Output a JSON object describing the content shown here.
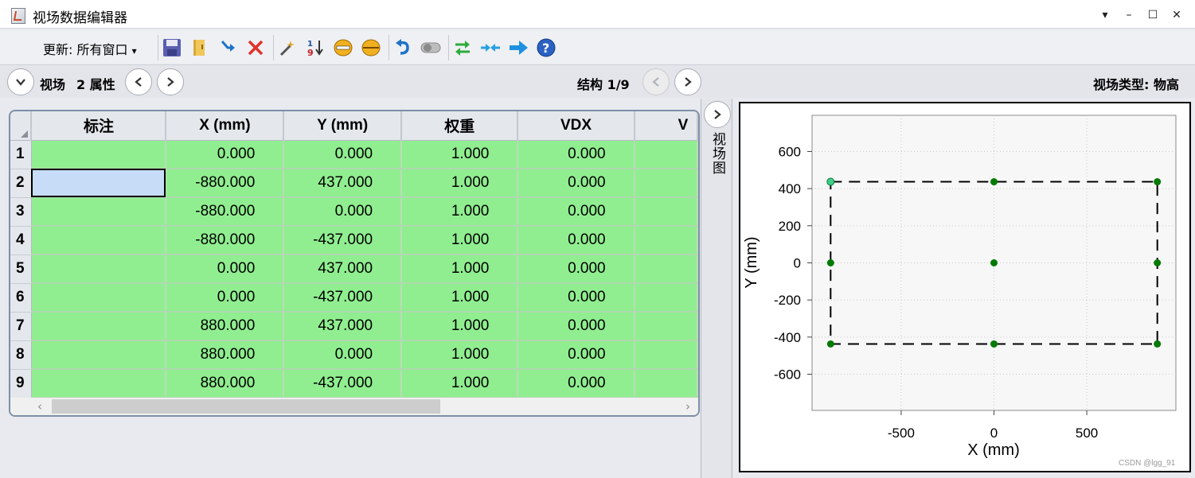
{
  "window": {
    "title": "视场数据编辑器",
    "controls": [
      "▾",
      "–",
      "☐",
      "✕"
    ]
  },
  "toolbar": {
    "update_label": "更新: 所有窗口",
    "update_arrow": "▾"
  },
  "nav": {
    "field_label": "视场",
    "property_label": "2 属性",
    "structure_label": "结构 1/9",
    "field_type_label": "视场类型: 物高"
  },
  "table": {
    "columns": [
      "标注",
      "X (mm)",
      "Y (mm)",
      "权重",
      "VDX",
      "V"
    ],
    "rows": [
      {
        "num": "1",
        "label": "",
        "x": "0.000",
        "y": "0.000",
        "weight": "1.000",
        "vdx": "0.000"
      },
      {
        "num": "2",
        "label": "",
        "x": "-880.000",
        "y": "437.000",
        "weight": "1.000",
        "vdx": "0.000"
      },
      {
        "num": "3",
        "label": "",
        "x": "-880.000",
        "y": "0.000",
        "weight": "1.000",
        "vdx": "0.000"
      },
      {
        "num": "4",
        "label": "",
        "x": "-880.000",
        "y": "-437.000",
        "weight": "1.000",
        "vdx": "0.000"
      },
      {
        "num": "5",
        "label": "",
        "x": "0.000",
        "y": "437.000",
        "weight": "1.000",
        "vdx": "0.000"
      },
      {
        "num": "6",
        "label": "",
        "x": "0.000",
        "y": "-437.000",
        "weight": "1.000",
        "vdx": "0.000"
      },
      {
        "num": "7",
        "label": "",
        "x": "880.000",
        "y": "437.000",
        "weight": "1.000",
        "vdx": "0.000"
      },
      {
        "num": "8",
        "label": "",
        "x": "880.000",
        "y": "0.000",
        "weight": "1.000",
        "vdx": "0.000"
      },
      {
        "num": "9",
        "label": "",
        "x": "880.000",
        "y": "-437.000",
        "weight": "1.000",
        "vdx": "0.000"
      }
    ]
  },
  "side_panel": {
    "label": "视场图"
  },
  "watermark": "CSDN @lgg_91",
  "colors": {
    "cell_green": "#90ee90",
    "selected_cell": "#c7dcf6",
    "point_green": "#007a00",
    "point_selected": "#3fcf86"
  },
  "chart_data": {
    "type": "scatter",
    "xlabel": "X (mm)",
    "ylabel": "Y (mm)",
    "xlim": [
      -980,
      980
    ],
    "ylim": [
      -795,
      795
    ],
    "xticks": [
      -500,
      0,
      500
    ],
    "yticks": [
      600,
      400,
      200,
      0,
      -200,
      -400,
      -600
    ],
    "grid": true,
    "points": [
      {
        "x": 0,
        "y": 0
      },
      {
        "x": -880,
        "y": 437,
        "selected": true
      },
      {
        "x": -880,
        "y": 0
      },
      {
        "x": -880,
        "y": -437
      },
      {
        "x": 0,
        "y": 437
      },
      {
        "x": 0,
        "y": -437
      },
      {
        "x": 880,
        "y": 437
      },
      {
        "x": 880,
        "y": 0
      },
      {
        "x": 880,
        "y": -437
      }
    ],
    "outline": {
      "x_min": -880,
      "x_max": 880,
      "y_min": -437,
      "y_max": 437,
      "style": "dashed"
    }
  }
}
